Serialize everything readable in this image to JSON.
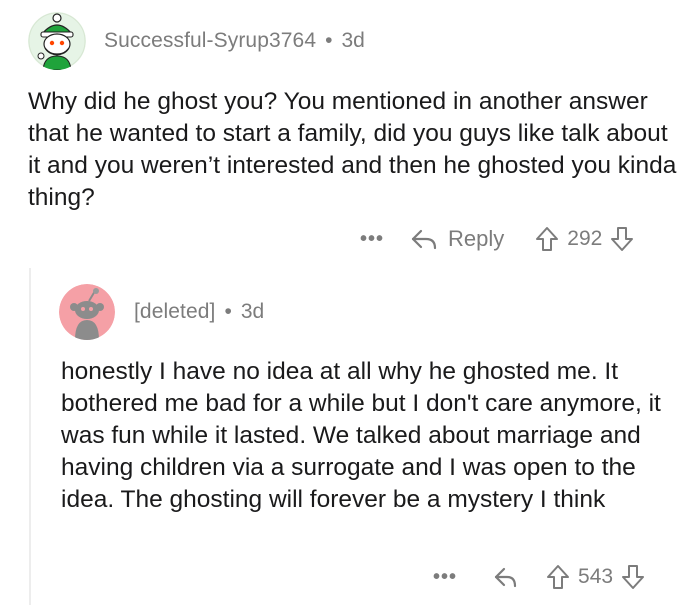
{
  "comments": [
    {
      "username": "Successful-Syrup3764",
      "separator": "•",
      "age": "3d",
      "avatar_icon": "snoo-avatar-icon",
      "avatar_color": "#e9f7e5",
      "text": "Why did he ghost you? You mentioned in another answer that he wanted to start a family, did you guys like talk about it and you weren’t interested and then he ghosted you kinda thing?",
      "more_label": "•••",
      "reply_label": "Reply",
      "score": "292"
    },
    {
      "username": "[deleted]",
      "separator": "•",
      "age": "3d",
      "avatar_icon": "deleted-user-avatar-icon",
      "avatar_color": "#f5a0a6",
      "text": "honestly I have no idea at all why he ghosted me. It bothered me bad for a while but I don't care anymore, it was fun while it lasted. We talked about marriage and having children via a surrogate and I was open to the idea. The ghosting will forever be a mystery I think",
      "more_label": "•••",
      "score": "543"
    }
  ],
  "colors": {
    "meta_gray": "#7c7c7c",
    "text": "#1a1a1b",
    "thread_line": "#ededed"
  }
}
